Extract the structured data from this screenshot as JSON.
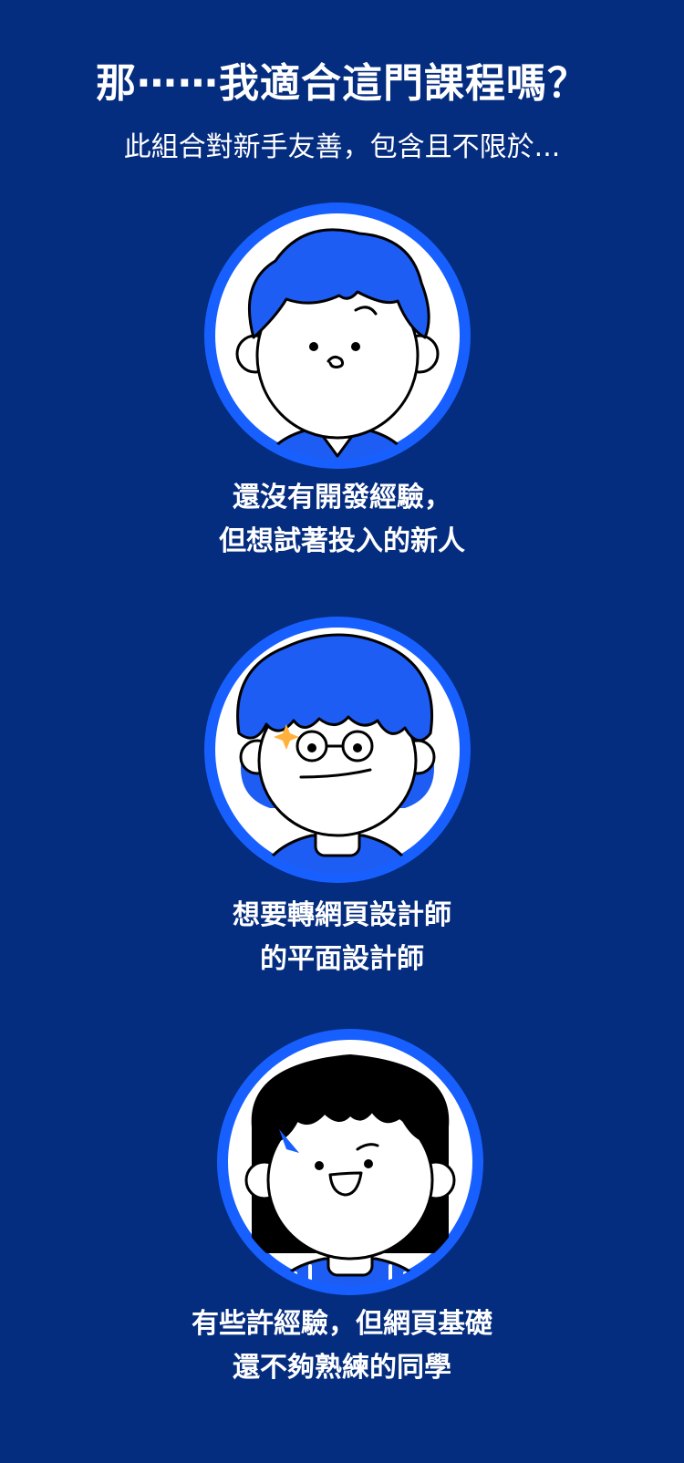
{
  "header": {
    "title": "那⋯⋯我適合這門課程嗎？",
    "subtitle": "此組合對新手友善，包含且不限於..."
  },
  "personas": [
    {
      "avatar_icon": "beginner-boy-avatar-icon",
      "lines": [
        "還沒有開發經驗，",
        "但想試著投入的新人"
      ]
    },
    {
      "avatar_icon": "designer-glasses-avatar-icon",
      "lines": [
        "想要轉網頁設計師",
        "的平面設計師"
      ]
    },
    {
      "avatar_icon": "student-girl-avatar-icon",
      "lines": [
        "有些許經驗，但網頁基礎",
        "還不夠熟練的同學"
      ]
    }
  ],
  "colors": {
    "background": "#042c7f",
    "ring": "#1760ff",
    "hair_blue": "#1e5df3",
    "accent": "#ffb13b"
  }
}
